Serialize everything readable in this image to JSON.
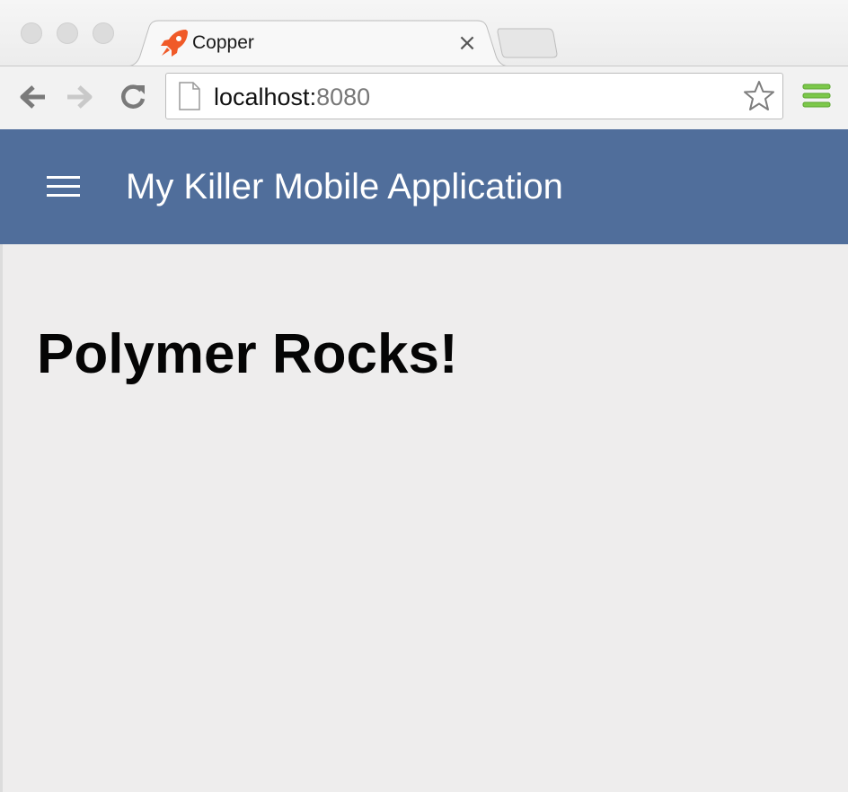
{
  "browser": {
    "tab": {
      "title": "Copper",
      "favicon": "rocket-icon",
      "favicon_color": "#f05a28",
      "close_glyph": "×"
    },
    "address_bar": {
      "host": "localhost:",
      "port": "8080"
    },
    "icons": {
      "back": "back-arrow-icon",
      "forward": "forward-arrow-icon",
      "reload": "reload-icon",
      "page": "page-icon",
      "bookmark": "star-icon",
      "menu": "chrome-menu-icon"
    },
    "menu_color": "#7cc84a"
  },
  "app": {
    "header": {
      "title": "My Killer Mobile Application",
      "background": "#506e9b",
      "menu_icon": "hamburger-menu-icon"
    },
    "main": {
      "heading": "Polymer Rocks!"
    }
  }
}
